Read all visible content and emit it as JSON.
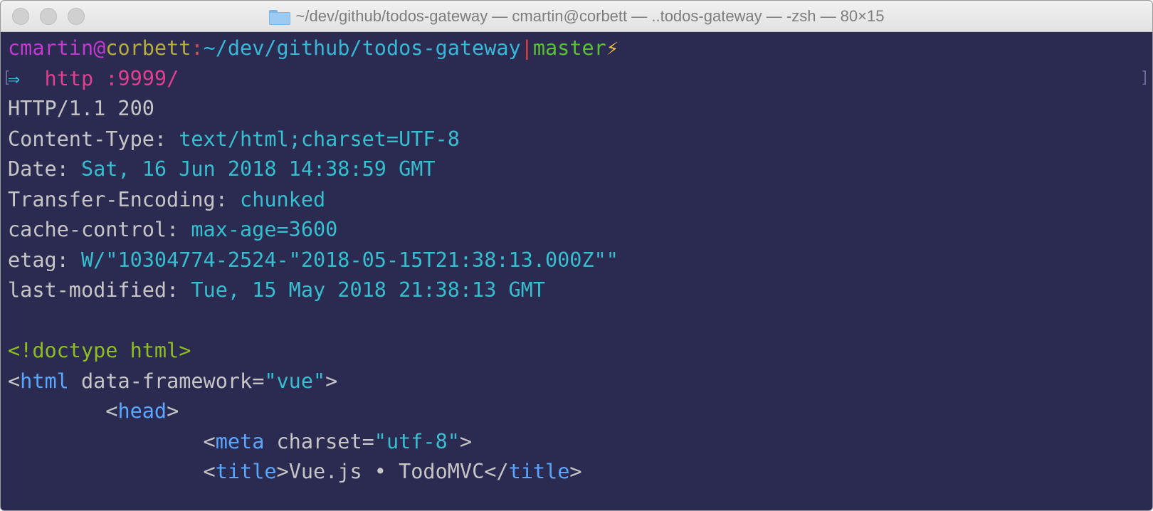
{
  "window": {
    "title": "~/dev/github/todos-gateway — cmartin@corbett — ..todos-gateway — -zsh — 80×15"
  },
  "prompt": {
    "user": "cmartin",
    "at": "@",
    "host": "corbett",
    "colon": ":",
    "path": "~/dev/github/todos-gateway",
    "separator": "|",
    "branch": "master",
    "status_glyph": "⚡"
  },
  "command": {
    "arrow": "⇒",
    "text": "http :9999/",
    "bracket_left": "[",
    "bracket_right": "]"
  },
  "response": {
    "status_line": "HTTP/1.1 200",
    "headers": [
      {
        "name": "Content-Type:",
        "value": "text/html;charset=UTF-8"
      },
      {
        "name": "Date:",
        "value": "Sat, 16 Jun 2018 14:38:59 GMT"
      },
      {
        "name": "Transfer-Encoding:",
        "value": "chunked"
      },
      {
        "name": "cache-control:",
        "value": "max-age=3600"
      },
      {
        "name": "etag:",
        "value": "W/\"10304774-2524-\"2018-05-15T21:38:13.000Z\"\""
      },
      {
        "name": "last-modified:",
        "value": "Tue, 15 May 2018 21:38:13 GMT"
      }
    ]
  },
  "body": {
    "doctype": "<!doctype html>",
    "html_tag": {
      "open": "<",
      "name": "html",
      "attr": " data-framework=",
      "value": "\"vue\"",
      "close": ">"
    },
    "head_tag": {
      "indent": "        ",
      "open": "<",
      "name": "head",
      "close": ">"
    },
    "meta_tag": {
      "indent": "                ",
      "open": "<",
      "name": "meta",
      "attr": " charset=",
      "value": "\"utf-8\"",
      "close": ">"
    },
    "title_tag": {
      "indent": "                ",
      "open": "<",
      "name": "title",
      "close": ">",
      "content": "Vue.js • TodoMVC",
      "end_open": "</",
      "end_name": "title",
      "end_close": ">"
    }
  },
  "colors": {
    "background": "#2b2a51",
    "user": "#c33ad0",
    "host": "#b8ad3c",
    "path": "#36b8d6",
    "branch": "#59c230",
    "command": "#e23f8e",
    "header_value": "#36bfcf",
    "doctype": "#8fbe1f",
    "tag": "#5aa7ff"
  }
}
